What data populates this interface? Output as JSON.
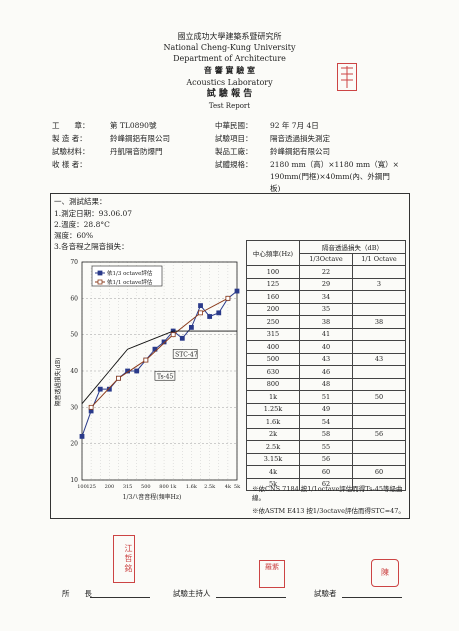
{
  "header": {
    "line1": "國立成功大學建築系暨研究所",
    "line2": "National Cheng-Kung University",
    "line3": "Department of Architecture",
    "line4": "音 響 實 驗 室",
    "line5": "Acoustics Laboratory",
    "line6": "試 驗 報 告",
    "line7": "Test Report"
  },
  "info": {
    "row1_l_label": "工　　章：",
    "row1_l_value": "第 TL0890號",
    "row1_r_label": "中華民國：",
    "row1_r_value": "92 年 7月 4日",
    "row2_l_label": "製 造 者：",
    "row2_l_value": "鈴峰鋼鋁有限公司",
    "row2_r_label": "試驗項目：",
    "row2_r_value": "隔音透過損失測定",
    "row3_l_label": "試驗材料：",
    "row3_l_value": "丹凱隔音防爆門",
    "row3_r_label": "製品工廠：",
    "row3_r_value": "鈴峰鋼鋁有限公司",
    "row4_l_label": "收 樣 者：",
    "row4_r_label": "試體規格：",
    "row4_r_value1": "2180 mm（高）×1180 mm（寬）×",
    "row4_r_value2": "190mm(門框)×40mm(內、外鋼門",
    "row4_r_value3": "板)"
  },
  "results": {
    "title": "一、測試結果：",
    "item1": "1.測定日期：93.06.07",
    "item2": "2.溫度：28.8°C",
    "item2b": "濕度：60%",
    "item3": "3.各音程之隔音損失："
  },
  "chart_data": {
    "type": "line",
    "title": "",
    "xlabel": "1/3八音音程(頻率Hz)",
    "ylabel": "隔音透過損失(dB)",
    "x_ticks": [
      "100",
      "125",
      "160",
      "200",
      "250",
      "315",
      "400",
      "500",
      "630",
      "800",
      "1k",
      "1.25k",
      "1.6k",
      "2k",
      "2.5k",
      "3.15k",
      "4k",
      "5k"
    ],
    "x_tick_labels": [
      "100",
      "125",
      "160",
      "200",
      "250",
      "315",
      "400",
      "500",
      "630",
      "800",
      "1k",
      "1.25k",
      "1.6k",
      "2k",
      "2.5k",
      "3.15k",
      "4k",
      "5k"
    ],
    "ylim": [
      10,
      70
    ],
    "y_ticks": [
      10,
      20,
      30,
      40,
      50,
      60,
      70
    ],
    "series": [
      {
        "name": "依1/3 octave評估",
        "marker": "square-filled",
        "values": [
          22,
          29,
          35,
          35,
          38,
          40,
          40,
          43,
          46,
          48,
          51,
          49,
          52,
          58,
          55,
          56,
          60,
          62
        ],
        "color": "#2a3a8a"
      },
      {
        "name": "依1/1 octave評估",
        "marker": "square-open",
        "values": [
          null,
          30,
          null,
          null,
          38,
          null,
          null,
          43,
          null,
          null,
          50,
          null,
          null,
          56,
          null,
          null,
          60,
          null
        ],
        "color": "#8a3a1a"
      },
      {
        "name": "STC-47",
        "marker": "none",
        "values": [
          31,
          34,
          37,
          40,
          43,
          46,
          47,
          48,
          49,
          50,
          51,
          51,
          51,
          51,
          51,
          51,
          51,
          51
        ],
        "color": "#111"
      }
    ],
    "annotations": [
      "STC-47",
      "Ts-45"
    ]
  },
  "table": {
    "group_header": "隔音透過損失（dB）",
    "col1": "中心頻率(Hz)",
    "col2": "1/3Octave",
    "col3": "1/1 Octave",
    "rows": [
      [
        "100",
        "22",
        ""
      ],
      [
        "125",
        "29",
        "3"
      ],
      [
        "160",
        "34",
        ""
      ],
      [
        "200",
        "35",
        ""
      ],
      [
        "250",
        "38",
        "38"
      ],
      [
        "315",
        "41",
        ""
      ],
      [
        "400",
        "40",
        ""
      ],
      [
        "500",
        "43",
        "43"
      ],
      [
        "630",
        "46",
        ""
      ],
      [
        "800",
        "48",
        ""
      ],
      [
        "1k",
        "51",
        "50"
      ],
      [
        "1.25k",
        "49",
        ""
      ],
      [
        "1.6k",
        "54",
        ""
      ],
      [
        "2k",
        "58",
        "56"
      ],
      [
        "2.5k",
        "55",
        ""
      ],
      [
        "3.15k",
        "56",
        ""
      ],
      [
        "4k",
        "60",
        "60"
      ],
      [
        "5k",
        "62",
        ""
      ]
    ],
    "note1": "※依CNS 7184 按1/1octave評估而得Ts-45等級曲",
    "note1b": "線。",
    "note2": "※依ASTM E413 按1/3octave評估而得STC=47。"
  },
  "stamps": {
    "left": "江哲銘",
    "mid": "羅紫",
    "right": "陳"
  },
  "signatures": {
    "director": "所　　長",
    "supervisor": "試驗主持人",
    "tester": "試驗者"
  },
  "colors": {
    "ink": "#222222",
    "stamp": "#c44444",
    "series1": "#2a3a8a",
    "series2": "#8a3a1a"
  }
}
